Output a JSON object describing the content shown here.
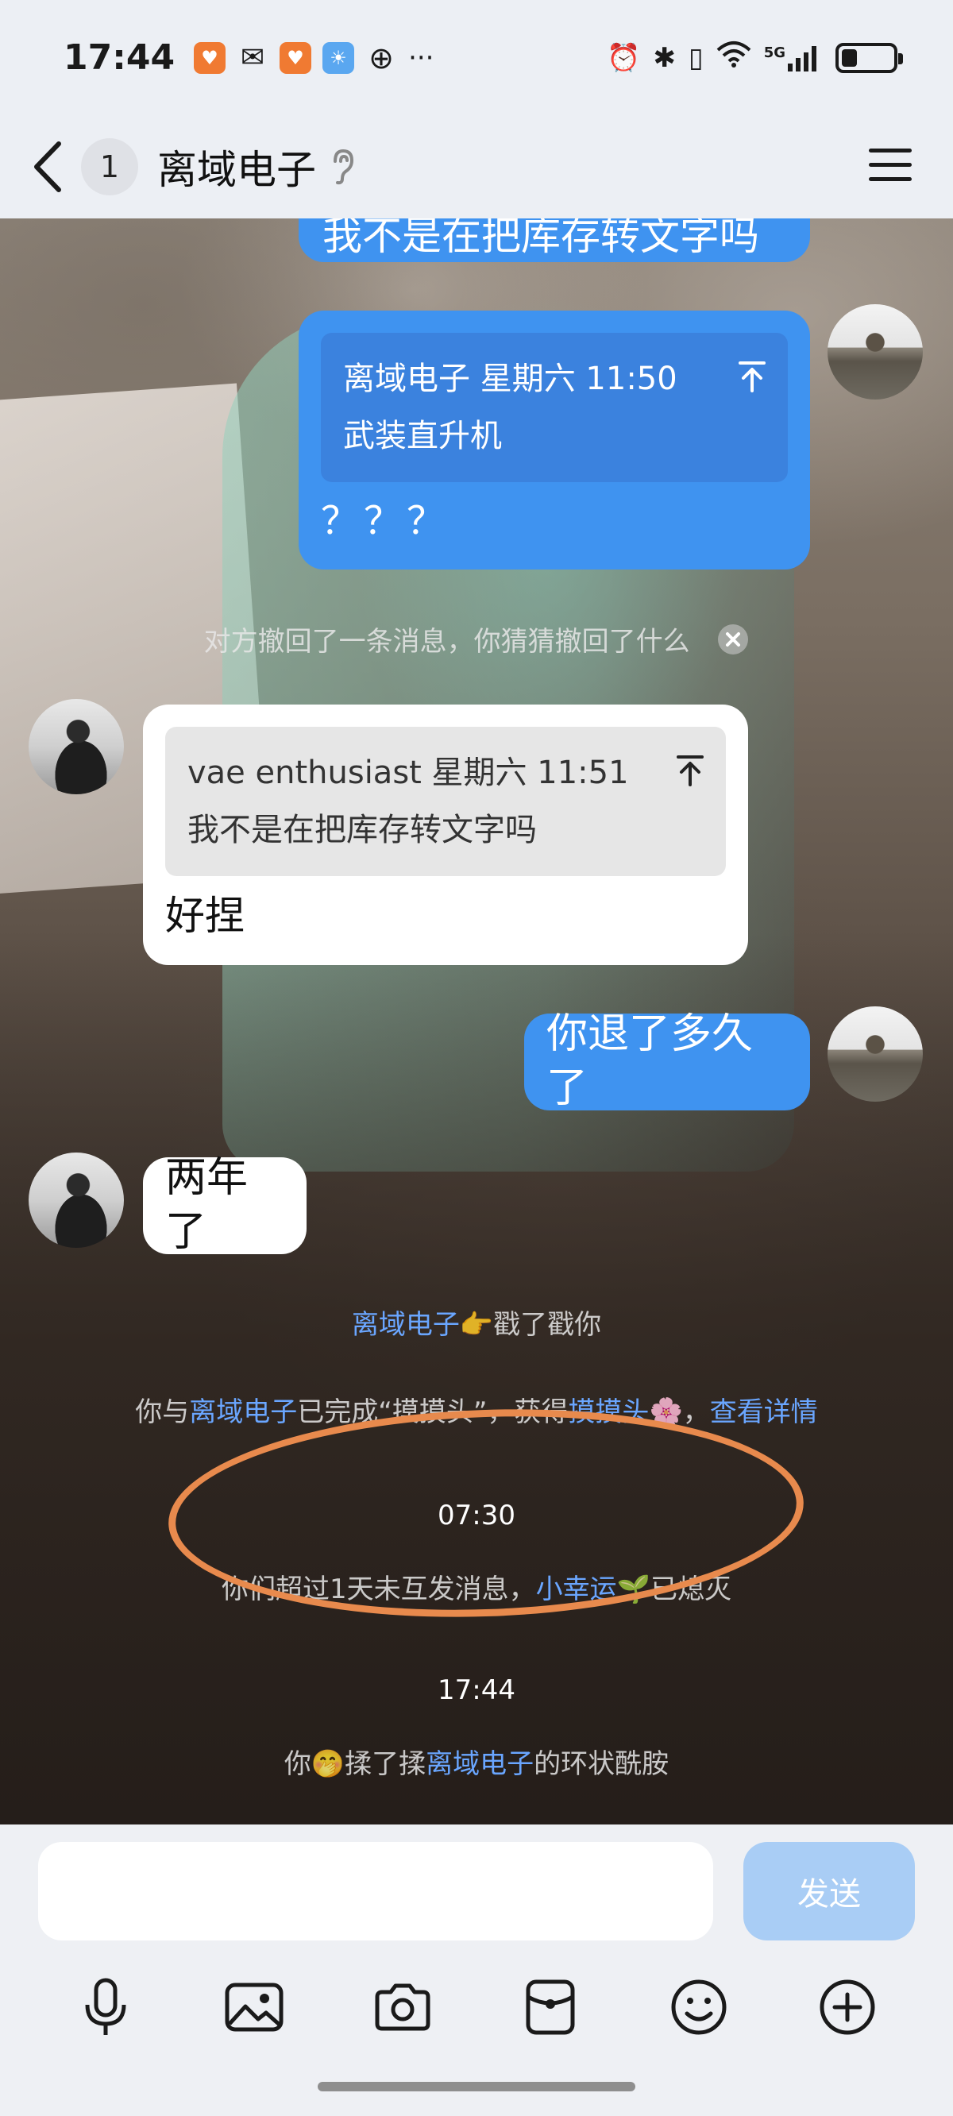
{
  "status_bar": {
    "time": "17:44",
    "icons": [
      "taobao-icon",
      "wechat-icon",
      "taobao-icon",
      "weather-icon",
      "globe-icon"
    ],
    "more": "···",
    "right_icons": [
      "alarm-icon",
      "bluetooth-icon",
      "vibrate-icon",
      "wifi-icon",
      "signal-5g-icon",
      "battery-icon"
    ],
    "network": "5G"
  },
  "header": {
    "unread_count": "1",
    "title": "离域电子"
  },
  "messages": {
    "partial_top_text": "我不是在把库存转文字吗",
    "msg1": {
      "quote_meta": "离域电子 星期六 11:50",
      "quote_text": "武装直升机",
      "text": "？？？"
    },
    "recall_notice": "对方撤回了一条消息，你猜猜撤回了什么",
    "msg2": {
      "quote_meta": "vae enthusiast 星期六 11:51",
      "quote_text": "我不是在把库存转文字吗",
      "text": "好捏"
    },
    "msg3": {
      "text": "你退了多久了"
    },
    "msg4": {
      "text": "两年了"
    }
  },
  "system": {
    "poke_name": "离域电子",
    "poke_emoji": "👉",
    "poke_text": "戳了戳你",
    "badge_prefix": "你与",
    "badge_name": "离域电子",
    "badge_mid": "已完成“摸摸头”，获得",
    "badge_item": "摸摸头",
    "badge_emoji": "🌸",
    "badge_sep": "，",
    "badge_link": "查看详情",
    "time1": "07:30",
    "streak_text": "你们超过1天未互发消息，",
    "streak_name": "小幸运",
    "streak_emoji": "🌱",
    "streak_end": "已熄灭",
    "time2": "17:44",
    "rub_prefix": "你",
    "rub_emoji": "🤭",
    "rub_mid": "揉了揉",
    "rub_name": "离域电子",
    "rub_end": "的环状酰胺"
  },
  "input": {
    "value": "",
    "send_label": "发送"
  },
  "toolbar": [
    "mic-icon",
    "image-icon",
    "camera-icon",
    "red-packet-icon",
    "emoji-icon",
    "plus-icon"
  ],
  "colors": {
    "outgoing_bubble": "#3f93f0",
    "incoming_bubble": "#ffffff",
    "link": "#6aa6ff",
    "annotation": "#e88a4d",
    "send_disabled": "#a9cdf5"
  }
}
